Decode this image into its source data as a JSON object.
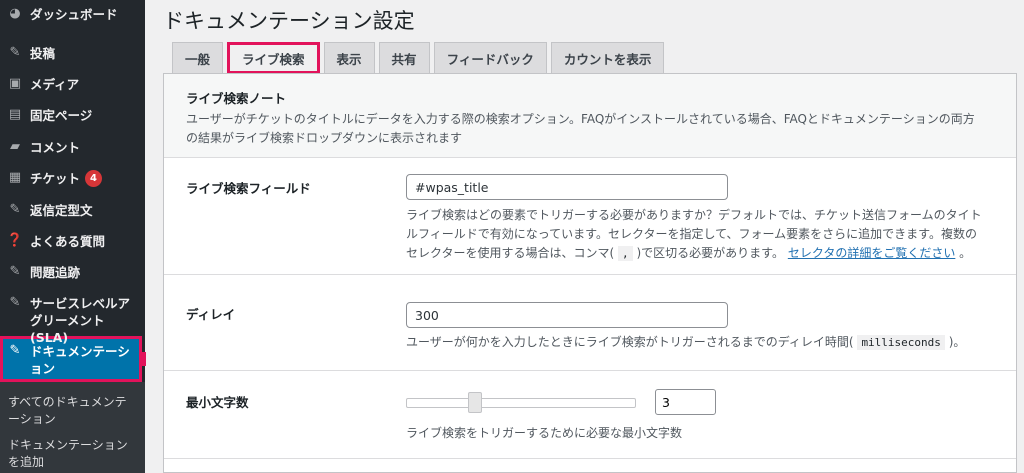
{
  "sidebar": {
    "items": [
      {
        "label": "ダッシュボード",
        "icon": "dashboard-icon"
      },
      {
        "label": "投稿",
        "icon": "pin-icon"
      },
      {
        "label": "メディア",
        "icon": "media-icon"
      },
      {
        "label": "固定ページ",
        "icon": "page-icon"
      },
      {
        "label": "コメント",
        "icon": "comment-icon"
      },
      {
        "label": "チケット",
        "icon": "ticket-icon",
        "badge": "4"
      },
      {
        "label": "返信定型文",
        "icon": "pin-icon"
      },
      {
        "label": "よくある質問",
        "icon": "help-icon"
      },
      {
        "label": "問題追跡",
        "icon": "pin-icon"
      },
      {
        "label": "サービスレベルアグリーメント(SLA)",
        "icon": "pin-icon"
      },
      {
        "label": "ドキュメンテーション",
        "icon": "pin-icon"
      }
    ],
    "submenu": [
      {
        "label": "すべてのドキュメンテーション"
      },
      {
        "label": "ドキュメンテーションを追加"
      }
    ]
  },
  "page": {
    "title": "ドキュメンテーション設定"
  },
  "tabs": [
    {
      "label": "一般"
    },
    {
      "label": "ライブ検索"
    },
    {
      "label": "表示"
    },
    {
      "label": "共有"
    },
    {
      "label": "フィードバック"
    },
    {
      "label": "カウントを表示"
    }
  ],
  "note": {
    "title": "ライブ検索ノート",
    "desc": "ユーザーがチケットのタイトルにデータを入力する際の検索オプション。FAQがインストールされている場合、FAQとドキュメンテーションの両方の結果がライブ検索ドロップダウンに表示されます"
  },
  "fields": {
    "live_search": {
      "label": "ライブ検索フィールド",
      "value": "#wpas_title",
      "help_pre": "ライブ検索はどの要素でトリガーする必要がありますか？デフォルトでは、チケット送信フォームのタイトルフィールドで有効になっています。セレクターを指定して、フォーム要素をさらに追加できます。複数のセレクターを使用する場合は、コンマ(",
      "help_code": ",",
      "help_mid": ")で区切る必要があります。",
      "help_link": "セレクタの詳細をご覧ください",
      "help_post": "。"
    },
    "delay": {
      "label": "ディレイ",
      "value": "300",
      "help_pre": "ユーザーが何かを入力したときにライブ検索がトリガーされるまでのディレイ時間(",
      "help_code": "milliseconds",
      "help_post": ")。"
    },
    "min_chars": {
      "label": "最小文字数",
      "value": "3",
      "help": "ライブ検索をトリガーするために必要な最小文字数"
    }
  },
  "colors": {
    "sidebar_bg": "#23282d",
    "active_bg": "#0073aa",
    "highlight": "#e2135b",
    "link": "#2271b1"
  }
}
